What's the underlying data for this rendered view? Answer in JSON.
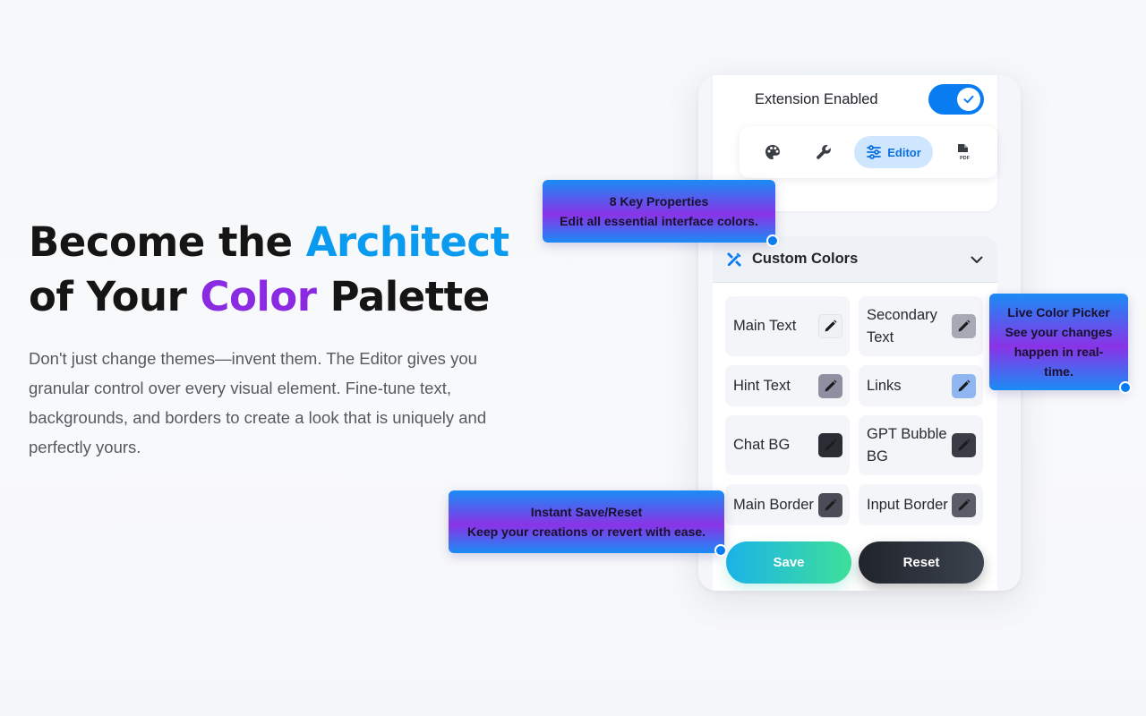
{
  "hero": {
    "title_part1": "Become the ",
    "title_accent1": "Architect",
    "title_part2": "of Your ",
    "title_accent2": "Color",
    "title_part3": " Palette",
    "description": "Don't just change themes—invent them. The Editor gives you granular control over every visual element. Fine-tune text, backgrounds, and borders to create a look that is uniquely and perfectly yours."
  },
  "panel": {
    "extension_label": "Extension Enabled",
    "toggle_on": true,
    "tabs": [
      {
        "icon": "palette-icon",
        "label": ""
      },
      {
        "icon": "wrench-icon",
        "label": ""
      },
      {
        "icon": "sliders-icon",
        "label": "Editor"
      },
      {
        "icon": "pdf-file-icon",
        "label": "PDF"
      }
    ],
    "section_title": "Custom Colors",
    "colors": [
      {
        "label": "Main Text",
        "swatch": "#f0f1f3"
      },
      {
        "label": "Secondary Text",
        "swatch": "#a7a9b5"
      },
      {
        "label": "Hint Text",
        "swatch": "#8e8fa0"
      },
      {
        "label": "Links",
        "swatch": "#8fb6f0"
      },
      {
        "label": "Chat BG",
        "swatch": "#2b2d35"
      },
      {
        "label": "GPT Bubble BG",
        "swatch": "#3a3d46"
      },
      {
        "label": "Main Border",
        "swatch": "#4a4d57"
      },
      {
        "label": "Input Border",
        "swatch": "#5a5d67"
      }
    ],
    "save_label": "Save",
    "reset_label": "Reset"
  },
  "callouts": {
    "key_props": {
      "title": "8 Key Properties",
      "text": "Edit all essential interface colors."
    },
    "color_picker": {
      "title": "Live Color Picker",
      "text": "See your changes happen in real-time."
    },
    "save_reset": {
      "title": "Instant Save/Reset",
      "text": "Keep your creations or revert with ease."
    }
  },
  "colors": {
    "accent_blue": "#0a9bf0",
    "accent_purple": "#8a2be2",
    "toggle_blue": "#0a7cf2"
  }
}
